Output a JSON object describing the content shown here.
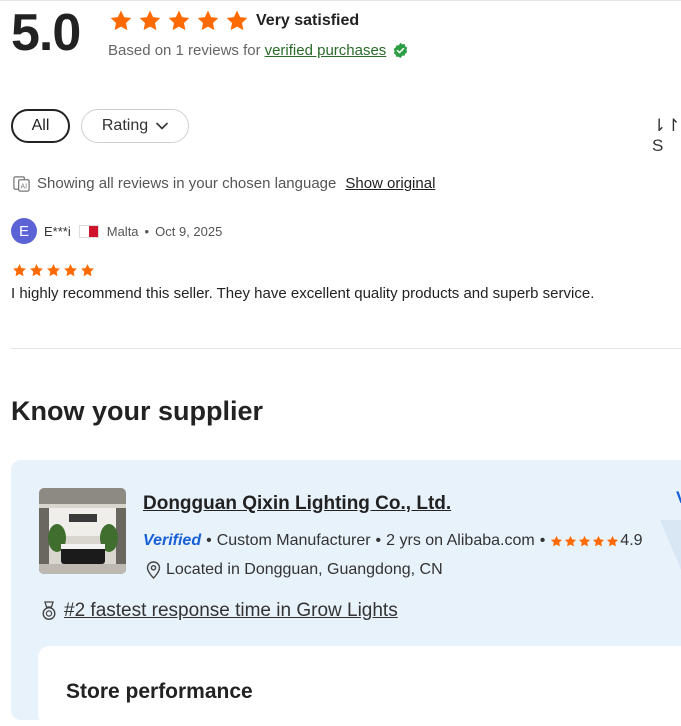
{
  "summary": {
    "score": "5.0",
    "stars": 5,
    "sentiment": "Very satisfied",
    "based_on": "Based on 1 reviews for",
    "verified_link": "verified purchases",
    "star_color": "#ff6a00"
  },
  "filters": {
    "all_label": "All",
    "rating_label": "Rating"
  },
  "sort_label": "⇂↾ S",
  "language": {
    "notice": "Showing all reviews in your chosen language",
    "show_original": "Show original"
  },
  "review": {
    "avatar_letter": "E",
    "name": "E***i",
    "country": "Malta",
    "date": "Oct 9, 2025",
    "stars": 5,
    "text": "I highly recommend this seller. They have excellent quality products and superb service."
  },
  "supplier": {
    "heading": "Know your supplier",
    "company": "Dongguan Qixin Lighting Co., Ltd.",
    "verified": "Verified",
    "type": "Custom Manufacturer",
    "years": "2 yrs on Alibaba.com",
    "rating": "4.9",
    "location": "Located in Dongguan, Guangdong, CN",
    "response": "#2 fastest response time in Grow Lights",
    "corner_text": "V",
    "store_performance": "Store performance",
    "brand_color": "#1860d6",
    "card_color": "#e8f2fb"
  }
}
